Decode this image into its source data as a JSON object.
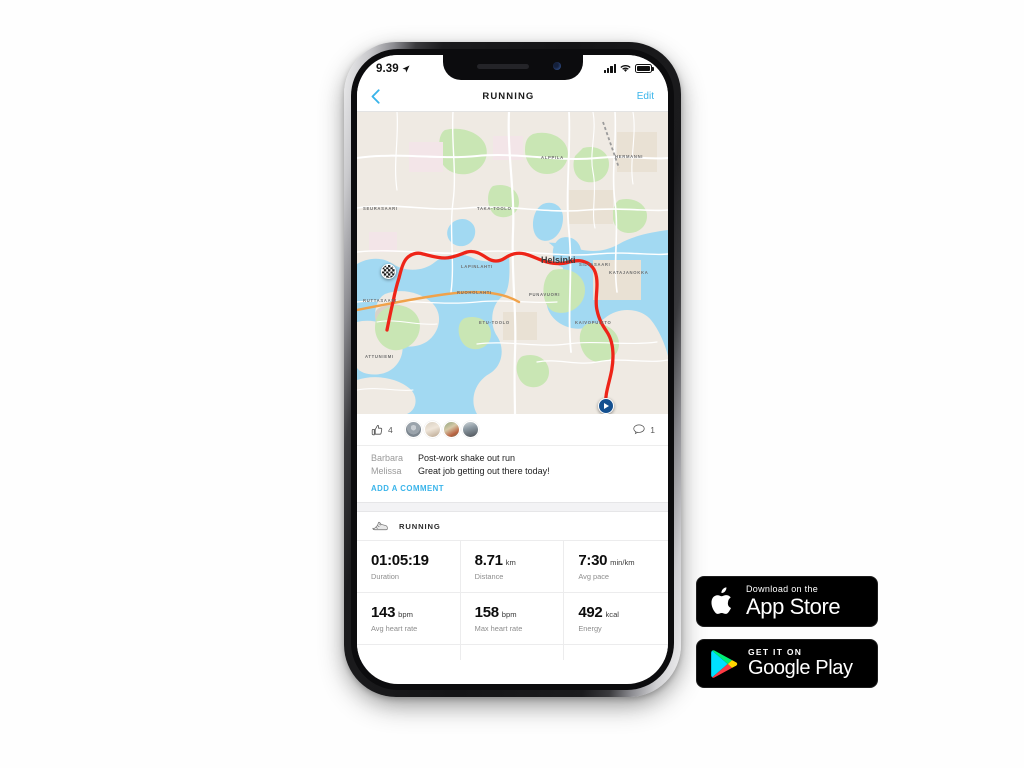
{
  "status_bar": {
    "time": "9.39",
    "location_icon": "location-arrow-icon",
    "signal_icon": "cellular-signal-icon",
    "wifi_icon": "wifi-icon",
    "battery_icon": "battery-full-icon"
  },
  "nav": {
    "back_icon": "chevron-left-icon",
    "title": "RUNNING",
    "edit_label": "Edit"
  },
  "map": {
    "city_label": "Helsinki",
    "route_color": "#ee2418",
    "water_color": "#a2d9f2",
    "land_color": "#efeae3",
    "park_color": "#c9e6b4",
    "finish_marker": "checkered-flag-marker",
    "start_marker": "start-play-marker",
    "labels": [
      "ALPPILA",
      "HERMANNI",
      "TAKA-TOOLO",
      "ETU-TOOLO",
      "SILTASAARI",
      "KATAJANOKKA",
      "PUNAVUORI",
      "RUOHOLAHTI",
      "KAIVOPUISTO",
      "LAPINLAHTI",
      "RUTTASAARI",
      "ATTUNIEMI",
      "SEURASAARI"
    ]
  },
  "social": {
    "like_icon": "thumbs-up-icon",
    "like_count": "4",
    "comment_icon": "speech-bubble-icon",
    "comment_count": "1",
    "avatars": [
      "avatar-1",
      "avatar-2",
      "avatar-3",
      "avatar-4"
    ],
    "comments": [
      {
        "user": "Barbara",
        "text": "Post-work shake out run"
      },
      {
        "user": "Melissa",
        "text": "Great job getting out there today!"
      }
    ],
    "add_comment_label": "ADD A COMMENT"
  },
  "activity": {
    "icon": "running-shoe-icon",
    "label": "RUNNING",
    "stats": [
      {
        "value": "01:05:19",
        "unit": "",
        "caption": "Duration"
      },
      {
        "value": "8.71",
        "unit": "km",
        "caption": "Distance"
      },
      {
        "value": "7:30",
        "unit": "min/km",
        "caption": "Avg pace"
      },
      {
        "value": "143",
        "unit": "bpm",
        "caption": "Avg heart rate"
      },
      {
        "value": "158",
        "unit": "bpm",
        "caption": "Max heart rate"
      },
      {
        "value": "492",
        "unit": "kcal",
        "caption": "Energy"
      }
    ]
  },
  "store_badges": {
    "apple": {
      "icon": "apple-logo-icon",
      "small": "Download on the",
      "big": "App Store"
    },
    "google": {
      "icon": "google-play-triangle-icon",
      "small": "GET IT ON",
      "big": "Google Play"
    }
  },
  "theme": {
    "accent": "#39b4ea",
    "route": "#ee2418",
    "start_marker": "#14508f"
  }
}
